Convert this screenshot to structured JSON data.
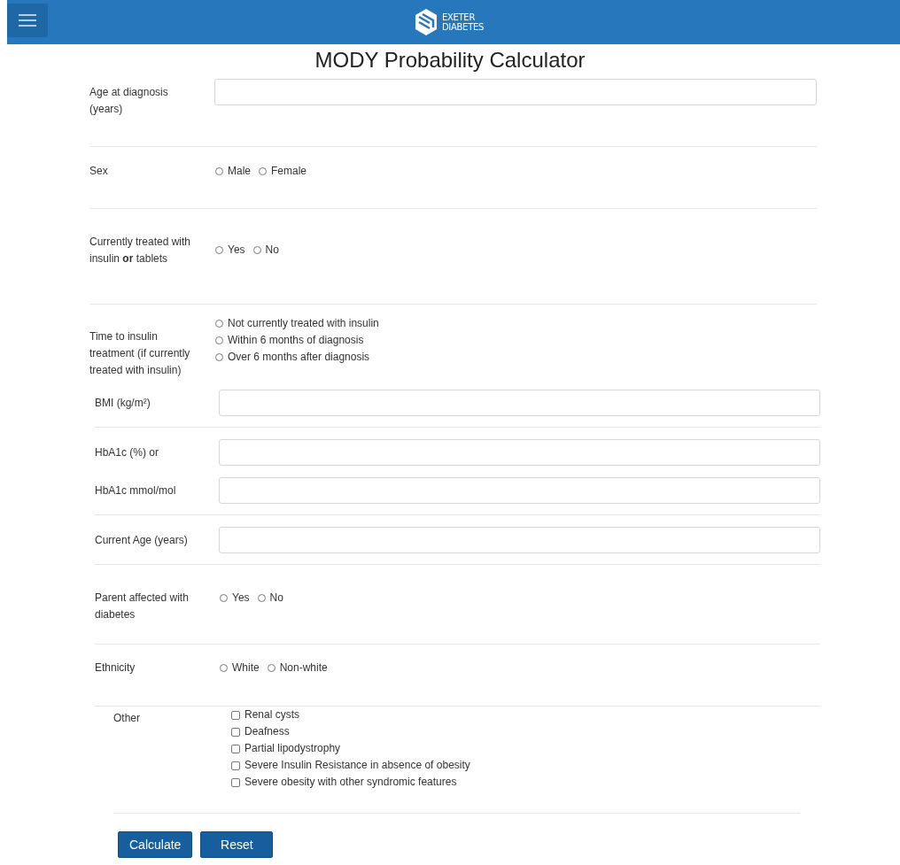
{
  "header": {
    "logo_line_1": "EXETER",
    "logo_line_2": "DIABETES"
  },
  "title": "MODY Probability Calculator",
  "blocks": [
    {
      "groups": [
        {
          "rows": [
            {
              "label": "Age at diagnosis (years)",
              "kind": "text"
            }
          ]
        },
        {
          "rows": [
            {
              "label": "Sex",
              "kind": "radio",
              "options": [
                {
                  "label": "Male",
                  "selected": false
                },
                {
                  "label": "Female",
                  "selected": false
                }
              ]
            }
          ]
        },
        {
          "rows": [
            {
              "label": "Currently treated with insulin **or** tablets",
              "kind": "radio",
              "options": [
                {
                  "label": "Yes",
                  "selected": false
                },
                {
                  "label": "No",
                  "selected": false
                }
              ]
            }
          ]
        },
        {
          "rows": [
            {
              "label": "Time to insulin treatment (if currently treated with insulin)",
              "kind": "radio_stack",
              "options": [
                {
                  "label": "Not currently treated with insulin",
                  "selected": false
                },
                {
                  "label": "Within 6 months of diagnosis",
                  "selected": false
                },
                {
                  "label": "Over 6 months after diagnosis",
                  "selected": false
                }
              ]
            }
          ]
        }
      ]
    },
    {
      "groups": [
        {
          "rows": [
            {
              "label": "BMI (kg/m²)",
              "kind": "text"
            }
          ]
        },
        {
          "rows": [
            {
              "label": "HbA1c (%) or",
              "kind": "text"
            },
            {
              "label": "HbA1c mmol/mol",
              "kind": "text"
            }
          ]
        },
        {
          "rows": [
            {
              "label": "Current Age (years)",
              "kind": "text"
            }
          ]
        },
        {
          "rows": [
            {
              "label": "Parent affected with diabetes",
              "kind": "radio",
              "options": [
                {
                  "label": "Yes",
                  "selected": false
                },
                {
                  "label": "No",
                  "selected": false
                }
              ]
            }
          ]
        },
        {
          "rows": [
            {
              "label": "Ethnicity",
              "kind": "radio",
              "options": [
                {
                  "label": "White",
                  "selected": false
                },
                {
                  "label": "Non-white",
                  "selected": false
                }
              ]
            }
          ]
        }
      ]
    },
    {
      "groups": [
        {
          "rows": [
            {
              "label": "Other",
              "kind": "checkboxes",
              "options": [
                {
                  "label": "Renal cysts",
                  "checked": false
                },
                {
                  "label": "Deafness",
                  "checked": false
                },
                {
                  "label": "Partial lipodystrophy",
                  "checked": false
                },
                {
                  "label": "Severe Insulin Resistance in absence of obesity",
                  "checked": false
                },
                {
                  "label": "Severe obesity with other syndromic features",
                  "checked": false
                }
              ]
            }
          ]
        }
      ]
    }
  ],
  "buttons": [
    "Calculate",
    "Reset"
  ]
}
